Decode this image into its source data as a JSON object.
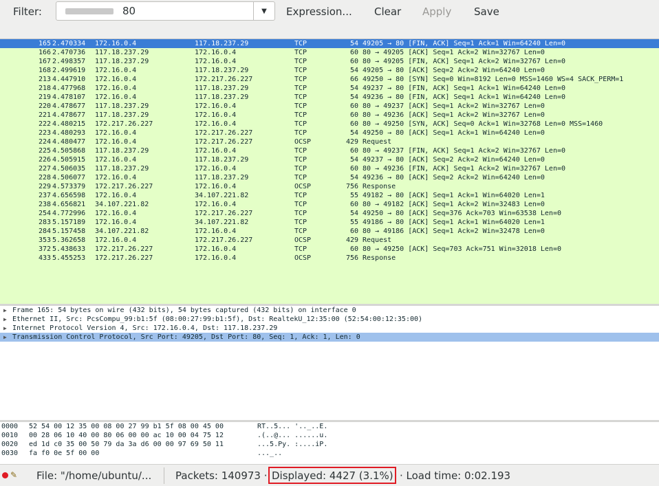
{
  "filter": {
    "label": "Filter:",
    "value": "80",
    "dropdown_icon": "chevron-down-icon",
    "buttons": {
      "expression": "Expression...",
      "clear": "Clear",
      "apply": "Apply",
      "save": "Save"
    }
  },
  "colors": {
    "row_bg": "#e4ffc7",
    "selected_row": "#3a7dd6",
    "highlight_box": "#e01b24"
  },
  "packets": [
    [
      "165",
      "2.470334",
      "172.16.0.4",
      "117.18.237.29",
      "TCP",
      "54",
      "49205 → 80 [FIN, ACK] Seq=1 Ack=1 Win=64240 Len=0"
    ],
    [
      "166",
      "2.470736",
      "117.18.237.29",
      "172.16.0.4",
      "TCP",
      "60",
      "80 → 49205 [ACK] Seq=1 Ack=2 Win=32767 Len=0"
    ],
    [
      "167",
      "2.498357",
      "117.18.237.29",
      "172.16.0.4",
      "TCP",
      "60",
      "80 → 49205 [FIN, ACK] Seq=1 Ack=2 Win=32767 Len=0"
    ],
    [
      "168",
      "2.499619",
      "172.16.0.4",
      "117.18.237.29",
      "TCP",
      "54",
      "49205 → 80 [ACK] Seq=2 Ack=2 Win=64240 Len=0"
    ],
    [
      "213",
      "4.447910",
      "172.16.0.4",
      "172.217.26.227",
      "TCP",
      "66",
      "49250 → 80 [SYN] Seq=0 Win=8192 Len=0 MSS=1460 WS=4 SACK_PERM=1"
    ],
    [
      "218",
      "4.477968",
      "172.16.0.4",
      "117.18.237.29",
      "TCP",
      "54",
      "49237 → 80 [FIN, ACK] Seq=1 Ack=1 Win=64240 Len=0"
    ],
    [
      "219",
      "4.478107",
      "172.16.0.4",
      "117.18.237.29",
      "TCP",
      "54",
      "49236 → 80 [FIN, ACK] Seq=1 Ack=1 Win=64240 Len=0"
    ],
    [
      "220",
      "4.478677",
      "117.18.237.29",
      "172.16.0.4",
      "TCP",
      "60",
      "80 → 49237 [ACK] Seq=1 Ack=2 Win=32767 Len=0"
    ],
    [
      "221",
      "4.478677",
      "117.18.237.29",
      "172.16.0.4",
      "TCP",
      "60",
      "80 → 49236 [ACK] Seq=1 Ack=2 Win=32767 Len=0"
    ],
    [
      "222",
      "4.480215",
      "172.217.26.227",
      "172.16.0.4",
      "TCP",
      "60",
      "80 → 49250 [SYN, ACK] Seq=0 Ack=1 Win=32768 Len=0 MSS=1460"
    ],
    [
      "223",
      "4.480293",
      "172.16.0.4",
      "172.217.26.227",
      "TCP",
      "54",
      "49250 → 80 [ACK] Seq=1 Ack=1 Win=64240 Len=0"
    ],
    [
      "224",
      "4.480477",
      "172.16.0.4",
      "172.217.26.227",
      "OCSP",
      "429",
      "Request"
    ],
    [
      "225",
      "4.505868",
      "117.18.237.29",
      "172.16.0.4",
      "TCP",
      "60",
      "80 → 49237 [FIN, ACK] Seq=1 Ack=2 Win=32767 Len=0"
    ],
    [
      "226",
      "4.505915",
      "172.16.0.4",
      "117.18.237.29",
      "TCP",
      "54",
      "49237 → 80 [ACK] Seq=2 Ack=2 Win=64240 Len=0"
    ],
    [
      "227",
      "4.506035",
      "117.18.237.29",
      "172.16.0.4",
      "TCP",
      "60",
      "80 → 49236 [FIN, ACK] Seq=1 Ack=2 Win=32767 Len=0"
    ],
    [
      "228",
      "4.506077",
      "172.16.0.4",
      "117.18.237.29",
      "TCP",
      "54",
      "49236 → 80 [ACK] Seq=2 Ack=2 Win=64240 Len=0"
    ],
    [
      "229",
      "4.573379",
      "172.217.26.227",
      "172.16.0.4",
      "OCSP",
      "756",
      "Response"
    ],
    [
      "237",
      "4.656598",
      "172.16.0.4",
      "34.107.221.82",
      "TCP",
      "55",
      "49182 → 80 [ACK] Seq=1 Ack=1 Win=64020 Len=1"
    ],
    [
      "238",
      "4.656821",
      "34.107.221.82",
      "172.16.0.4",
      "TCP",
      "60",
      "80 → 49182 [ACK] Seq=1 Ack=2 Win=32483 Len=0"
    ],
    [
      "254",
      "4.772996",
      "172.16.0.4",
      "172.217.26.227",
      "TCP",
      "54",
      "49250 → 80 [ACK] Seq=376 Ack=703 Win=63538 Len=0"
    ],
    [
      "283",
      "5.157189",
      "172.16.0.4",
      "34.107.221.82",
      "TCP",
      "55",
      "49186 → 80 [ACK] Seq=1 Ack=1 Win=64020 Len=1"
    ],
    [
      "284",
      "5.157458",
      "34.107.221.82",
      "172.16.0.4",
      "TCP",
      "60",
      "80 → 49186 [ACK] Seq=1 Ack=2 Win=32478 Len=0"
    ],
    [
      "353",
      "5.362658",
      "172.16.0.4",
      "172.217.26.227",
      "OCSP",
      "429",
      "Request"
    ],
    [
      "372",
      "5.438633",
      "172.217.26.227",
      "172.16.0.4",
      "TCP",
      "60",
      "80 → 49250 [ACK] Seq=703 Ack=751 Win=32018 Len=0"
    ],
    [
      "433",
      "5.455253",
      "172.217.26.227",
      "172.16.0.4",
      "OCSP",
      "756",
      "Response"
    ]
  ],
  "details": [
    "Frame 165: 54 bytes on wire (432 bits), 54 bytes captured (432 bits) on interface 0",
    "Ethernet II, Src: PcsCompu_99:b1:5f (08:00:27:99:b1:5f), Dst: RealtekU_12:35:00 (52:54:00:12:35:00)",
    "Internet Protocol Version 4, Src: 172.16.0.4, Dst: 117.18.237.29",
    "Transmission Control Protocol, Src Port: 49205, Dst Port: 80, Seq: 1, Ack: 1, Len: 0"
  ],
  "hex": [
    [
      "0000",
      "52 54 00 12 35 00 08 00  27 99 b1 5f 08 00 45 00",
      "RT..5... '.._..E."
    ],
    [
      "0010",
      "00 28 06 10 40 00 80 06  00 00 ac 10 00 04 75 12",
      ".(..@... ......u."
    ],
    [
      "0020",
      "ed 1d c0 35 00 50 79 da  3a d6 00 00 97 69 50 11",
      "...5.Py. :....iP."
    ],
    [
      "0030",
      "fa f0 0e 5f 00 00",
      "..._.."
    ]
  ],
  "status": {
    "file": "File: \"/home/ubuntu/...",
    "packets": "Packets: 140973 ·",
    "displayed": "Displayed: 4427 (3.1%)",
    "load": "· Load time: 0:02.193"
  }
}
